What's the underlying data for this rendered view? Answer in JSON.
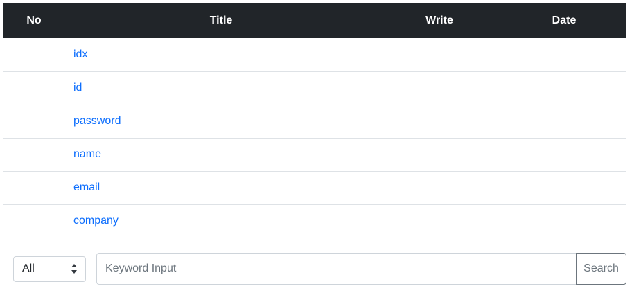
{
  "table": {
    "headers": {
      "no": "No",
      "title": "Title",
      "write": "Write",
      "date": "Date"
    },
    "rows": [
      {
        "no": "",
        "title": "idx",
        "write": "",
        "date": ""
      },
      {
        "no": "",
        "title": "id",
        "write": "",
        "date": ""
      },
      {
        "no": "",
        "title": "password",
        "write": "",
        "date": ""
      },
      {
        "no": "",
        "title": "name",
        "write": "",
        "date": ""
      },
      {
        "no": "",
        "title": "email",
        "write": "",
        "date": ""
      },
      {
        "no": "",
        "title": "company",
        "write": "",
        "date": ""
      }
    ]
  },
  "search": {
    "filter_selected": "All",
    "keyword_placeholder": "Keyword Input",
    "keyword_value": "",
    "button_label": "Search",
    "chevron_icon": "chevron-updown-icon"
  },
  "colors": {
    "header_bg": "#212529",
    "link": "#0d6efd",
    "row_border": "#dee2e6"
  }
}
